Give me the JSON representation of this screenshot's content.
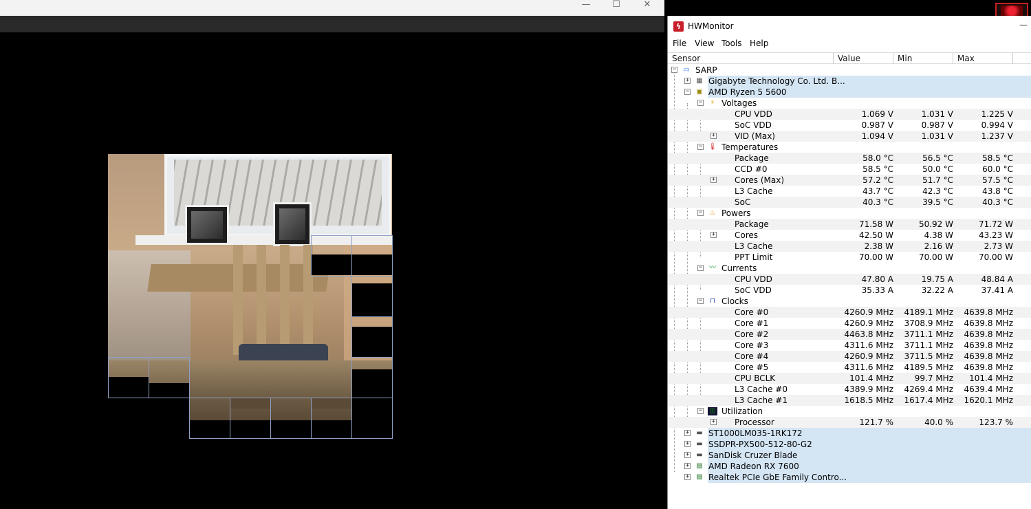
{
  "left_window": {
    "controls": {
      "minimize": "—",
      "maximize": "☐",
      "close": "✕"
    }
  },
  "hwmonitor": {
    "title": "HWMonitor",
    "menu": [
      "File",
      "View",
      "Tools",
      "Help"
    ],
    "columns": [
      "Sensor",
      "Value",
      "Min",
      "Max"
    ],
    "tree": {
      "root": "SARP",
      "motherboard": "Gigabyte Technology Co. Ltd. B...",
      "cpu": "AMD Ryzen 5 5600",
      "groups": {
        "voltages": {
          "label": "Voltages",
          "rows": [
            {
              "name": "CPU VDD",
              "value": "1.069 V",
              "min": "1.031 V",
              "max": "1.225 V"
            },
            {
              "name": "SoC VDD",
              "value": "0.987 V",
              "min": "0.987 V",
              "max": "0.994 V"
            },
            {
              "name": "VID (Max)",
              "value": "1.094 V",
              "min": "1.031 V",
              "max": "1.237 V"
            }
          ]
        },
        "temperatures": {
          "label": "Temperatures",
          "rows": [
            {
              "name": "Package",
              "value": "58.0 °C",
              "min": "56.5 °C",
              "max": "58.5 °C"
            },
            {
              "name": "CCD #0",
              "value": "58.5 °C",
              "min": "50.0 °C",
              "max": "60.0 °C"
            },
            {
              "name": "Cores (Max)",
              "value": "57.2 °C",
              "min": "51.7 °C",
              "max": "57.5 °C"
            },
            {
              "name": "L3 Cache",
              "value": "43.7 °C",
              "min": "42.3 °C",
              "max": "43.8 °C"
            },
            {
              "name": "SoC",
              "value": "40.3 °C",
              "min": "39.5 °C",
              "max": "40.3 °C"
            }
          ]
        },
        "powers": {
          "label": "Powers",
          "rows": [
            {
              "name": "Package",
              "value": "71.58 W",
              "min": "50.92 W",
              "max": "71.72 W"
            },
            {
              "name": "Cores",
              "value": "42.50 W",
              "min": "4.38 W",
              "max": "43.23 W"
            },
            {
              "name": "L3 Cache",
              "value": "2.38 W",
              "min": "2.16 W",
              "max": "2.73 W"
            },
            {
              "name": "PPT Limit",
              "value": "70.00 W",
              "min": "70.00 W",
              "max": "70.00 W"
            }
          ]
        },
        "currents": {
          "label": "Currents",
          "rows": [
            {
              "name": "CPU VDD",
              "value": "47.80 A",
              "min": "19.75 A",
              "max": "48.84 A"
            },
            {
              "name": "SoC VDD",
              "value": "35.33 A",
              "min": "32.22 A",
              "max": "37.41 A"
            }
          ]
        },
        "clocks": {
          "label": "Clocks",
          "rows": [
            {
              "name": "Core #0",
              "value": "4260.9 MHz",
              "min": "4189.1 MHz",
              "max": "4639.8 MHz"
            },
            {
              "name": "Core #1",
              "value": "4260.9 MHz",
              "min": "3708.9 MHz",
              "max": "4639.8 MHz"
            },
            {
              "name": "Core #2",
              "value": "4463.8 MHz",
              "min": "3711.1 MHz",
              "max": "4639.8 MHz"
            },
            {
              "name": "Core #3",
              "value": "4311.6 MHz",
              "min": "3711.1 MHz",
              "max": "4639.8 MHz"
            },
            {
              "name": "Core #4",
              "value": "4260.9 MHz",
              "min": "3711.5 MHz",
              "max": "4639.8 MHz"
            },
            {
              "name": "Core #5",
              "value": "4311.6 MHz",
              "min": "4189.5 MHz",
              "max": "4639.8 MHz"
            },
            {
              "name": "CPU BCLK",
              "value": "101.4 MHz",
              "min": "99.7 MHz",
              "max": "101.4 MHz"
            },
            {
              "name": "L3 Cache #0",
              "value": "4389.9 MHz",
              "min": "4269.4 MHz",
              "max": "4639.4 MHz"
            },
            {
              "name": "L3 Cache #1",
              "value": "1618.5 MHz",
              "min": "1617.4 MHz",
              "max": "1620.1 MHz"
            }
          ]
        },
        "utilization": {
          "label": "Utilization",
          "rows": [
            {
              "name": "Processor",
              "value": "121.7 %",
              "min": "40.0 %",
              "max": "123.7 %"
            }
          ]
        }
      },
      "devices": [
        "ST1000LM035-1RK172",
        "SSDPR-PX500-512-80-G2",
        "SanDisk  Cruzer Blade",
        "AMD Radeon RX 7600",
        "Realtek PCIe GbE Family Contro..."
      ]
    }
  },
  "colors": {
    "highlight": "#d4e5f4",
    "grid_outline": "#8fa0c4",
    "app_icon": "#c8202a"
  }
}
